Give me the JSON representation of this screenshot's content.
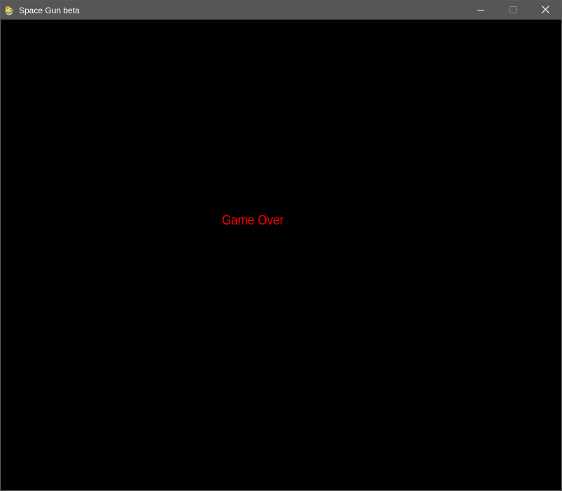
{
  "window": {
    "title": "Space Gun beta",
    "title_bar_color": "#565656",
    "icons": {
      "app": "pygame-snake-icon",
      "minimize": "minimize-icon",
      "maximize": "maximize-icon",
      "close": "close-icon"
    }
  },
  "game": {
    "background_color": "#000000",
    "message": "Game Over",
    "message_color": "#ff0000"
  }
}
